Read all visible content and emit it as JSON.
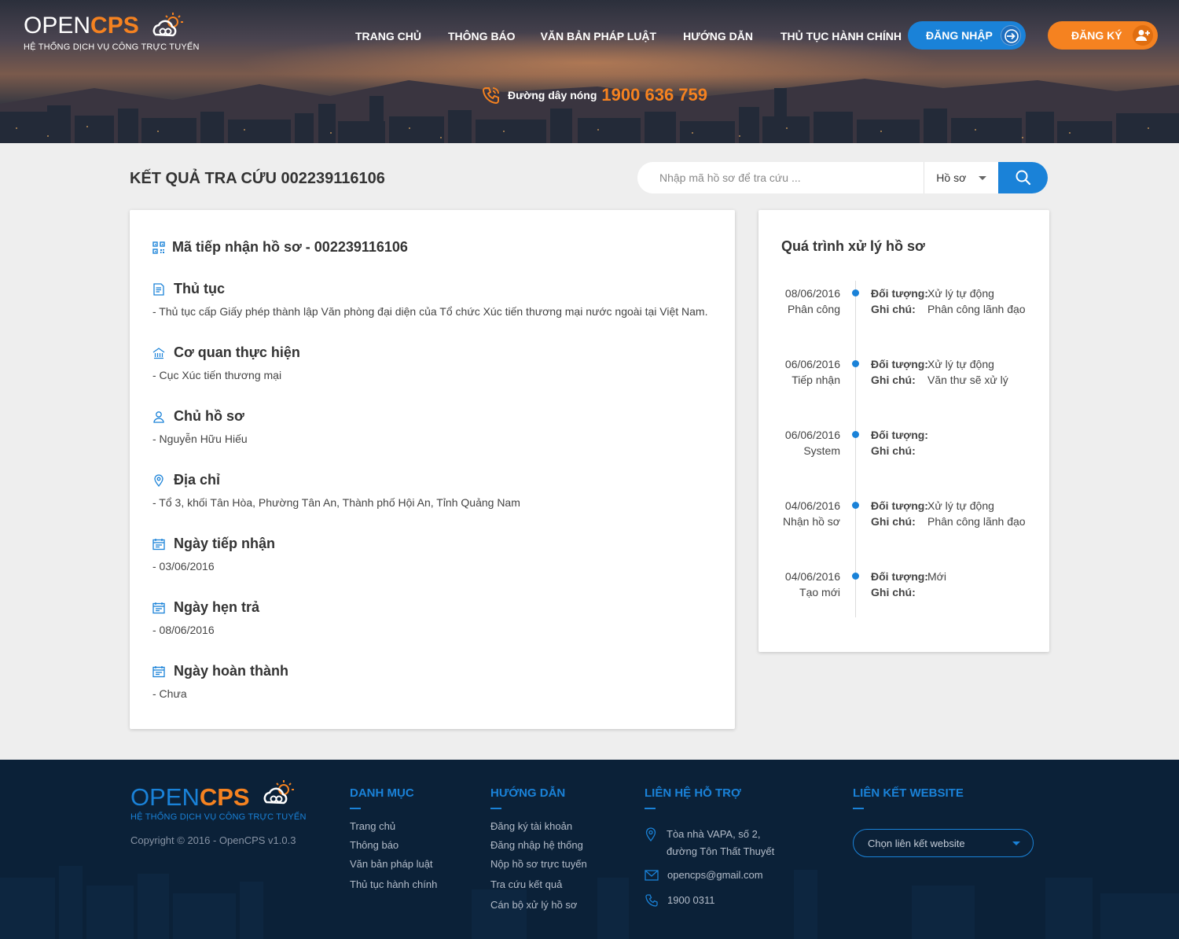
{
  "brand": {
    "logo_open": "OPEN",
    "logo_cps": "CPS",
    "tagline": "HỆ THỐNG DỊCH VỤ CÔNG TRỰC TUYẾN",
    "accent": "#f58220",
    "primary": "#1a82d8"
  },
  "nav": {
    "items": [
      {
        "label": "TRANG CHỦ"
      },
      {
        "label": "THÔNG BÁO"
      },
      {
        "label": "VĂN BẢN PHÁP LUẬT"
      },
      {
        "label": "HƯỚNG DẪN"
      },
      {
        "label": "THỦ TỤC HÀNH CHÍNH"
      }
    ],
    "login_label": "ĐĂNG NHẬP",
    "register_label": "ĐĂNG KÝ"
  },
  "hotline": {
    "label": "Đường dây nóng",
    "number": "1900 636 759"
  },
  "page": {
    "title": "KẾT QUẢ TRA CỨU 002239116106"
  },
  "search": {
    "placeholder": "Nhập mã hồ sơ để tra cứu ...",
    "type_selected": "Hồ sơ"
  },
  "detail": {
    "sections": [
      {
        "heading": "Mã tiếp nhận hồ sơ - 002239116106",
        "value": "",
        "icon": "qr-code-icon"
      },
      {
        "heading": "Thủ tục",
        "value": "- Thủ tục cấp Giấy phép thành lập Văn phòng đại diện của Tổ chức Xúc tiến thương mại nước ngoài tại Việt Nam.",
        "icon": "document-icon"
      },
      {
        "heading": "Cơ quan thực hiện",
        "value": "- Cục Xúc tiến thương mại",
        "icon": "building-icon"
      },
      {
        "heading": "Chủ hồ sơ",
        "value": "- Nguyễn Hữu Hiếu",
        "icon": "user-icon"
      },
      {
        "heading": "Địa chỉ",
        "value": "- Tổ 3, khối Tân Hòa, Phường Tân An, Thành phố Hội An, Tỉnh Quảng Nam",
        "icon": "location-icon"
      },
      {
        "heading": "Ngày tiếp nhận",
        "value": "- 03/06/2016",
        "icon": "calendar-icon"
      },
      {
        "heading": "Ngày hẹn trả",
        "value": "- 08/06/2016",
        "icon": "calendar-icon"
      },
      {
        "heading": "Ngày hoàn thành",
        "value": "- Chưa",
        "icon": "calendar-icon"
      }
    ]
  },
  "timeline": {
    "title": "Quá trình xử lý hồ sơ",
    "label_object": "Đối tượng:",
    "label_note": "Ghi chú:",
    "items": [
      {
        "date": "08/06/2016",
        "step": "Phân công",
        "object": "Xử lý tự động",
        "note": "Phân công lãnh đạo"
      },
      {
        "date": "06/06/2016",
        "step": "Tiếp nhận",
        "object": "Xử lý tự động",
        "note": "Văn thư sẽ xử lý"
      },
      {
        "date": "06/06/2016",
        "step": "System",
        "object": "",
        "note": ""
      },
      {
        "date": "04/06/2016",
        "step": "Nhận hồ sơ",
        "object": "Xử lý tự động",
        "note": "Phân công lãnh đạo"
      },
      {
        "date": "04/06/2016",
        "step": "Tạo mới",
        "object": "Mới",
        "note": ""
      }
    ]
  },
  "footer": {
    "copyright": "Copyright © 2016 - OpenCPS v1.0.3",
    "danh_muc": {
      "heading": "DANH MỤC",
      "links": [
        "Trang chủ",
        "Thông báo",
        "Văn bản pháp luật",
        "Thủ tục hành chính"
      ]
    },
    "huong_dan": {
      "heading": "HƯỚNG DẪN",
      "links": [
        "Đăng ký tài khoản",
        "Đăng nhập hệ thống",
        "Nộp hồ sơ trực tuyến",
        "Tra cứu kết quả",
        "Cán bộ xử lý hồ sơ"
      ]
    },
    "lien_he": {
      "heading": "LIÊN HỆ HỖ TRỢ",
      "address_line1": "Tòa nhà VAPA, số 2,",
      "address_line2": "đường Tôn Thất Thuyết",
      "email": "opencps@gmail.com",
      "phone": "1900 0311"
    },
    "lien_ket": {
      "heading": "LIÊN KẾT WEBSITE",
      "select_label": "Chọn liên kết website"
    }
  }
}
